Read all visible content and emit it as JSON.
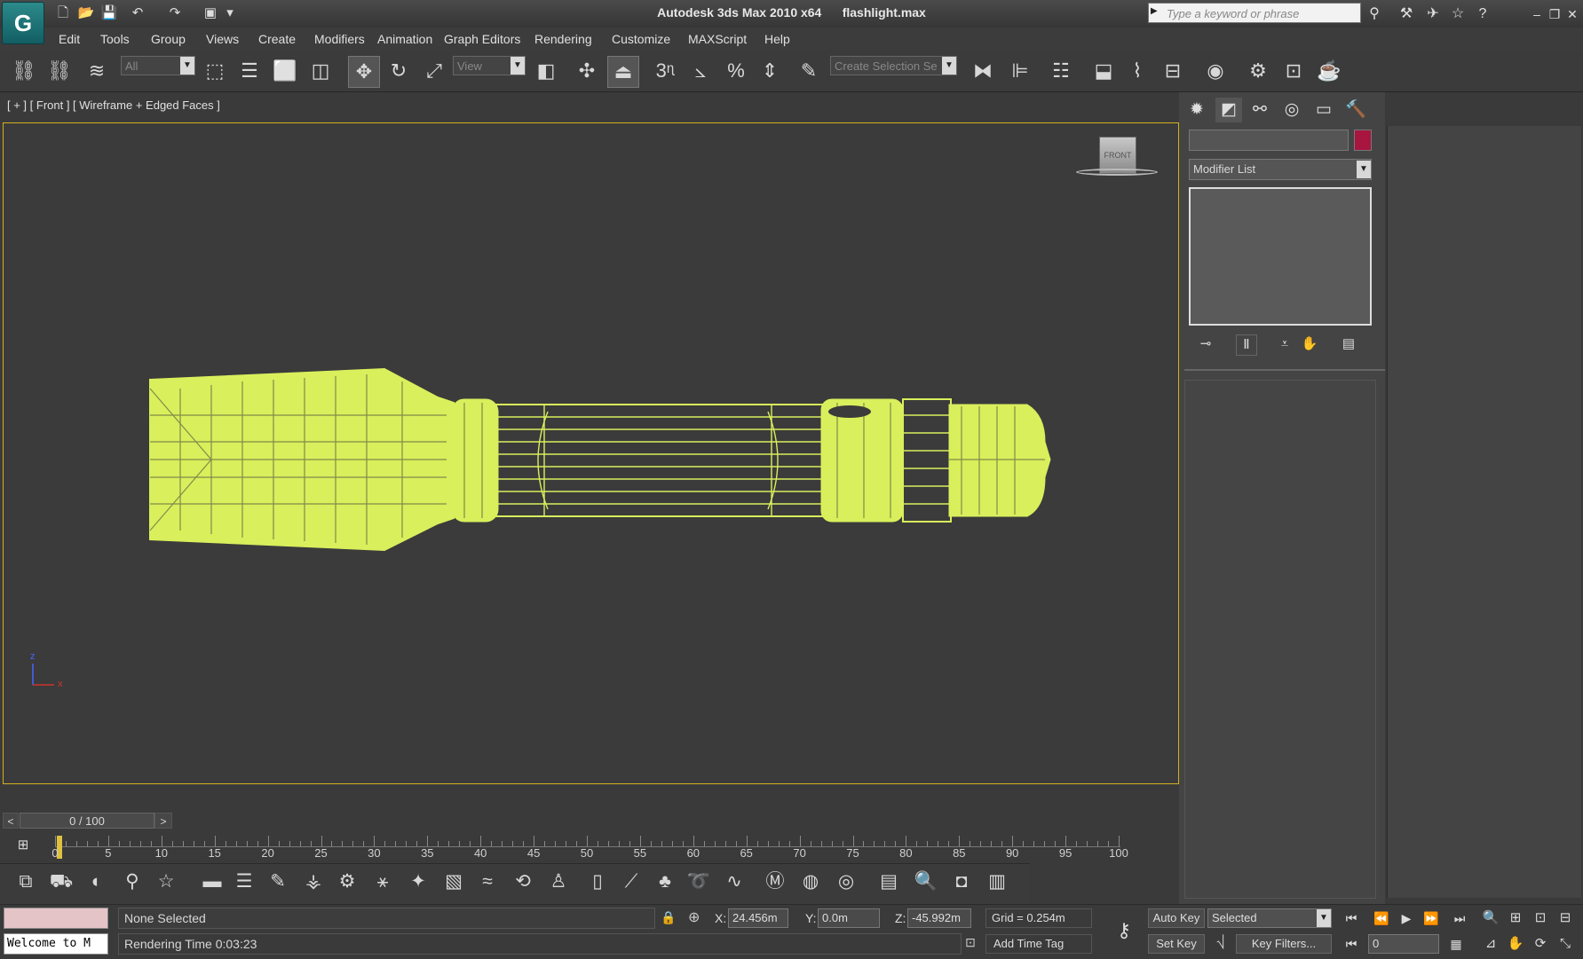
{
  "window": {
    "app_title": "Autodesk 3ds Max  2010 x64",
    "file_name": "flashlight.max"
  },
  "search": {
    "placeholder": "Type a keyword or phrase"
  },
  "menu": [
    "Edit",
    "Tools",
    "Group",
    "Views",
    "Create",
    "Modifiers",
    "Animation",
    "Graph Editors",
    "Rendering",
    "Customize",
    "MAXScript",
    "Help"
  ],
  "toolbar": {
    "selection_filter": "All",
    "reference_coord": "View",
    "snap_label": "3",
    "named_selection": "Create Selection Se"
  },
  "viewport": {
    "label": "[ + ] [ Front ] [ Wireframe + Edged Faces ]",
    "view_cube_label": "FRONT",
    "wire_color": "#d9ef5c",
    "axis_z": "z",
    "axis_x": "x"
  },
  "command_panel": {
    "modifier_list": "Modifier List",
    "object_color": "#a8153f"
  },
  "time_slider": {
    "position": "0 / 100",
    "left": "<",
    "right": ">"
  },
  "trackbar": {
    "ticks": [
      "0",
      "5",
      "10",
      "15",
      "20",
      "25",
      "30",
      "35",
      "40",
      "45",
      "50",
      "55",
      "60",
      "65",
      "70",
      "75",
      "80",
      "85",
      "90",
      "95",
      "100"
    ]
  },
  "status": {
    "listener_text": "Welcome to M",
    "selection": "None Selected",
    "rendering_time": "Rendering Time  0:03:23",
    "x_label": "X:",
    "x_value": "24.456m",
    "y_label": "Y:",
    "y_value": "0.0m",
    "z_label": "Z:",
    "z_value": "-45.992m",
    "grid": "Grid = 0.254m",
    "add_time_tag": "Add Time Tag",
    "auto_key": "Auto Key",
    "set_key": "Set Key",
    "key_mode": "Selected",
    "key_filters": "Key Filters...",
    "current_frame": "0"
  }
}
